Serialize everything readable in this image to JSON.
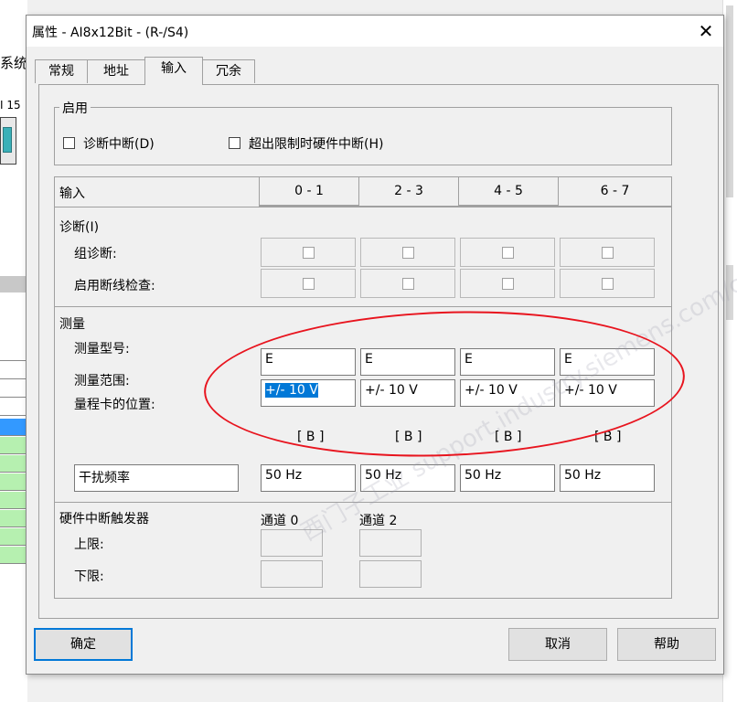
{
  "background": {
    "left_text_1": "系统",
    "left_text_2": "I 15"
  },
  "dialog": {
    "title": "属性 - AI8x12Bit - (R-/S4)",
    "close": "✕",
    "tabs": [
      "常规",
      "地址",
      "输入",
      "冗余"
    ],
    "active_tab": "输入",
    "enable_group": {
      "title": "启用",
      "diag_interrupt": "诊断中断(D)",
      "limit_interrupt": "超出限制时硬件中断(H)"
    },
    "table": {
      "input_label": "输入",
      "channels": [
        "0 - 1",
        "2 - 3",
        "4 - 5",
        "6 - 7"
      ],
      "diag_section": "诊断(I)",
      "group_diag": "组诊断:",
      "wire_break": "启用断线检查:",
      "measure_section": "测量",
      "measure_type_label": "测量型号:",
      "measure_types": [
        "E",
        "E",
        "E",
        "E"
      ],
      "measure_range_label": "测量范围:",
      "measure_ranges": [
        "+/- 10 V",
        "+/- 10 V",
        "+/- 10 V",
        "+/- 10 V"
      ],
      "range_card_label": "量程卡的位置:",
      "range_cards": [
        "[ B ]",
        "[ B ]",
        "[ B ]",
        "[ B ]"
      ],
      "interference_label": "干扰频率",
      "interference": [
        "50 Hz",
        "50 Hz",
        "50 Hz",
        "50 Hz"
      ]
    },
    "hw_interrupt": {
      "title": "硬件中断触发器",
      "channel0": "通道 0",
      "channel2": "通道 2",
      "upper": "上限:",
      "lower": "下限:"
    },
    "buttons": {
      "ok": "确定",
      "cancel": "取消",
      "help": "帮助"
    },
    "watermark": "西门子工业 support.industry.siemens.com/cs"
  }
}
